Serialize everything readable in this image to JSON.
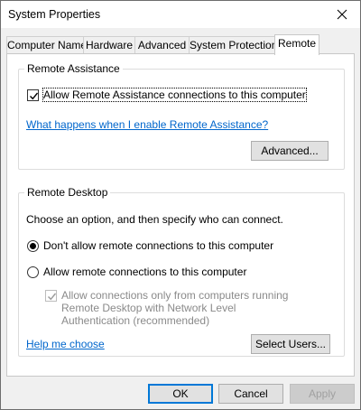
{
  "window": {
    "title": "System Properties"
  },
  "tabs": [
    {
      "label": "Computer Name",
      "active": false
    },
    {
      "label": "Hardware",
      "active": false
    },
    {
      "label": "Advanced",
      "active": false
    },
    {
      "label": "System Protection",
      "active": false
    },
    {
      "label": "Remote",
      "active": true
    }
  ],
  "remote_assistance": {
    "title": "Remote Assistance",
    "allow_checkbox": {
      "label": "Allow Remote Assistance connections to this computer",
      "checked": true
    },
    "help_link": "What happens when I enable Remote Assistance?",
    "advanced_button": "Advanced..."
  },
  "remote_desktop": {
    "title": "Remote Desktop",
    "instruction": "Choose an option, and then specify who can connect.",
    "option_dont_allow": {
      "label": "Don't allow remote connections to this computer",
      "selected": true
    },
    "option_allow": {
      "label": "Allow remote connections to this computer",
      "selected": false
    },
    "nla_checkbox": {
      "label": "Allow connections only from computers running Remote Desktop with Network Level Authentication (recommended)",
      "checked": true,
      "enabled": false
    },
    "help_link": "Help me choose",
    "select_users_button": "Select Users..."
  },
  "footer": {
    "ok": "OK",
    "cancel": "Cancel",
    "apply": "Apply"
  }
}
